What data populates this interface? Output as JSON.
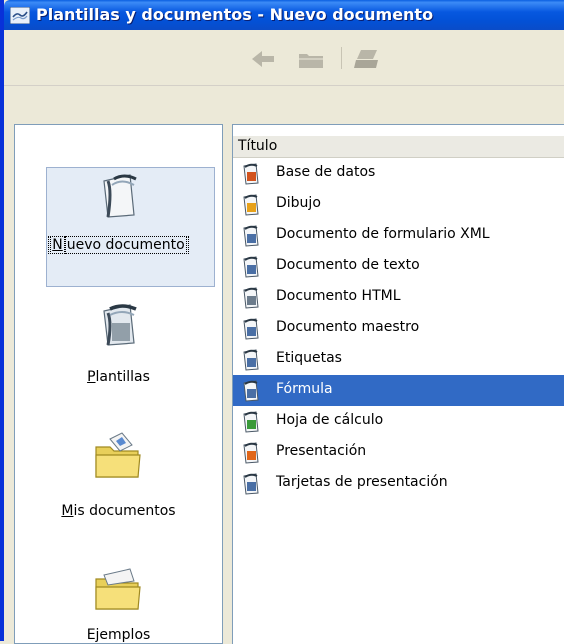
{
  "window": {
    "title": "Plantillas y documentos - Nuevo documento"
  },
  "toolbar": {
    "buttons": [
      {
        "icon": "back-arrow-icon"
      },
      {
        "icon": "folder-up-icon"
      },
      {
        "icon": "print-icon"
      }
    ]
  },
  "sidebar": {
    "items": [
      {
        "label": "Nuevo documento",
        "mnemonic": "N",
        "rest": "uevo documento",
        "icon": "new-document-icon",
        "selected": true
      },
      {
        "label": "Plantillas",
        "mnemonic": "P",
        "rest": "lantillas",
        "icon": "templates-icon",
        "selected": false
      },
      {
        "label": "Mis documentos",
        "mnemonic": "M",
        "rest": "is documentos",
        "icon": "my-documents-folder-icon",
        "selected": false
      },
      {
        "label": "Ejemplos",
        "mnemonic": "",
        "rest": "Ejemplos",
        "icon": "samples-folder-icon",
        "selected": false
      }
    ]
  },
  "list": {
    "column_header": "Título",
    "items": [
      {
        "label": "Base de datos",
        "icon": "database-icon",
        "color": "#D2531E"
      },
      {
        "label": "Dibujo",
        "icon": "draw-icon",
        "color": "#E7A11A"
      },
      {
        "label": "Documento de formulario XML",
        "icon": "xml-form-icon",
        "color": "#4A6FA5"
      },
      {
        "label": "Documento de texto",
        "icon": "text-document-icon",
        "color": "#4A6FA5"
      },
      {
        "label": "Documento HTML",
        "icon": "html-document-icon",
        "color": "#6C7C8C"
      },
      {
        "label": "Documento maestro",
        "icon": "master-document-icon",
        "color": "#4A6FA5"
      },
      {
        "label": "Etiquetas",
        "icon": "labels-icon",
        "color": "#4A6FA5"
      },
      {
        "label": "Fórmula",
        "icon": "formula-icon",
        "color": "#4A6FA5",
        "selected": true
      },
      {
        "label": "Hoja de cálculo",
        "icon": "spreadsheet-icon",
        "color": "#3A9A3A"
      },
      {
        "label": "Presentación",
        "icon": "presentation-icon",
        "color": "#E0661A"
      },
      {
        "label": "Tarjetas de presentación",
        "icon": "business-cards-icon",
        "color": "#4A6FA5"
      }
    ]
  },
  "colors": {
    "titlebar": "#0A5FE0",
    "selection": "#316AC5",
    "window_bg": "#ECE9D8"
  }
}
